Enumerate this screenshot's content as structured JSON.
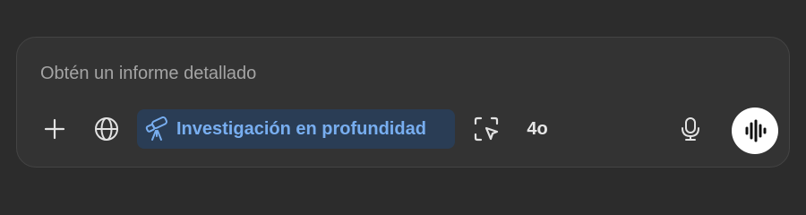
{
  "composer": {
    "placeholder": "Obtén un informe detallado"
  },
  "toolbar": {
    "add_icon": "plus-icon",
    "web_search_icon": "globe-icon",
    "research": {
      "icon": "telescope-icon",
      "label": "Investigación en profundidad",
      "active": true,
      "accent_color": "#78aef0"
    },
    "canvas_icon": "selection-cursor-icon",
    "model_label": "4o",
    "mic_icon": "microphone-icon",
    "voice_icon": "voice-waveform-icon"
  }
}
